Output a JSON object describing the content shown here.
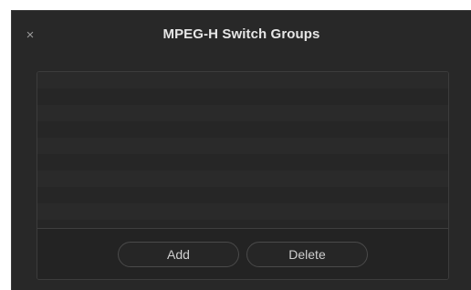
{
  "dialog": {
    "title": "MPEG-H Switch Groups",
    "close_glyph": "×",
    "close_icon": "close-icon"
  },
  "list": {
    "items": []
  },
  "footer": {
    "add_label": "Add",
    "delete_label": "Delete"
  }
}
